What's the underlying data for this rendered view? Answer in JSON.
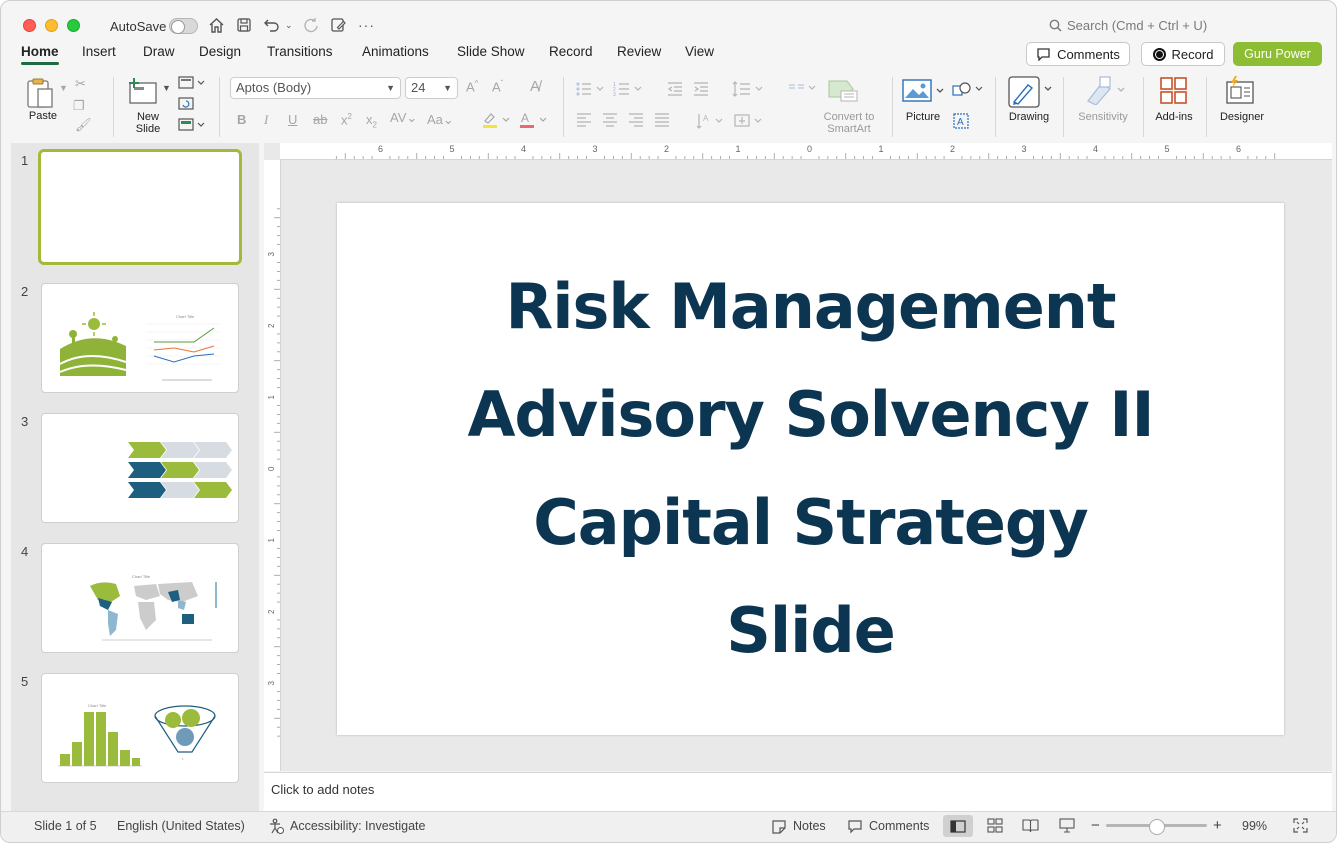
{
  "titlebar": {
    "autosave_label": "AutoSave",
    "search_placeholder": "Search (Cmd + Ctrl + U)"
  },
  "tabs": [
    "Home",
    "Insert",
    "Draw",
    "Design",
    "Transitions",
    "Animations",
    "Slide Show",
    "Record",
    "Review",
    "View"
  ],
  "tab_buttons": {
    "comments": "Comments",
    "record": "Record",
    "guru": "Guru Power"
  },
  "ribbon": {
    "paste": "Paste",
    "new_slide_1": "New",
    "new_slide_2": "Slide",
    "font_name": "Aptos (Body)",
    "font_size": "24",
    "convert_1": "Convert to",
    "convert_2": "SmartArt",
    "picture": "Picture",
    "drawing": "Drawing",
    "sensitivity": "Sensitivity",
    "addins": "Add-ins",
    "designer": "Designer"
  },
  "ruler": {
    "top_numbers": [
      "6",
      "5",
      "4",
      "3",
      "2",
      "1",
      "0",
      "1",
      "2",
      "3",
      "4",
      "5",
      "6"
    ],
    "left_numbers": [
      "3",
      "2",
      "1",
      "0",
      "1",
      "2",
      "3"
    ]
  },
  "thumbnails": [
    {
      "number": "1",
      "label": ""
    },
    {
      "number": "2",
      "label": ""
    },
    {
      "number": "3",
      "label": ""
    },
    {
      "number": "4",
      "label": ""
    },
    {
      "number": "5",
      "label": ""
    }
  ],
  "slide": {
    "title_lines": [
      "Risk Management",
      "Advisory Solvency II",
      "Capital Strategy",
      "Slide"
    ]
  },
  "notes_placeholder": "Click to add notes",
  "status": {
    "slide_counter": "Slide 1 of 5",
    "language": "English (United States)",
    "accessibility": "Accessibility: Investigate",
    "notes": "Notes",
    "comments": "Comments",
    "zoom": "99%"
  },
  "colors": {
    "accent_green": "#8dbd33",
    "title_navy": "#0b3550",
    "tab_underline": "#1d6b43"
  }
}
